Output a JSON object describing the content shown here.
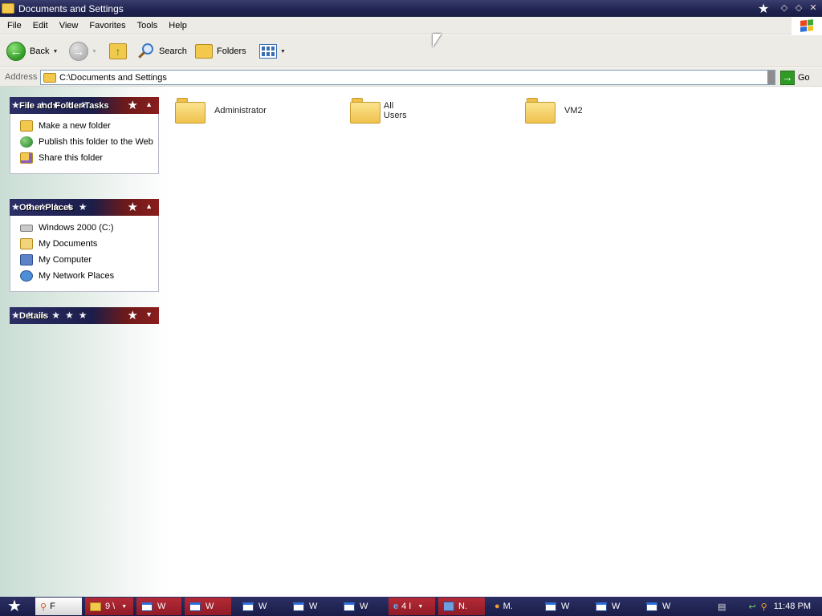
{
  "window": {
    "title": "Documents and Settings"
  },
  "menu": [
    "File",
    "Edit",
    "View",
    "Favorites",
    "Tools",
    "Help"
  ],
  "toolbar": {
    "back_label": "Back",
    "search_label": "Search",
    "folders_label": "Folders"
  },
  "address": {
    "label": "Address",
    "value": "C:\\Documents and Settings",
    "go_label": "Go"
  },
  "panels": {
    "tasks": {
      "title": "File and Folder Tasks",
      "items": [
        "Make a new folder",
        "Publish this folder to the Web",
        "Share this folder"
      ]
    },
    "other": {
      "title": "Other Places",
      "items": [
        "Windows 2000 (C:)",
        "My Documents",
        "My Computer",
        "My Network Places"
      ]
    },
    "details": {
      "title": "Details"
    }
  },
  "folders": [
    "Administrator",
    "All Users",
    "VM2"
  ],
  "taskbar": {
    "items": [
      "F",
      "9 \\",
      "W",
      "W",
      "W",
      "W",
      "W",
      "4 I",
      "N.",
      "M.",
      "W",
      "W",
      "W"
    ],
    "clock": "11:48 PM"
  },
  "icons": {
    "back": "back-arrow-icon",
    "forward": "forward-arrow-icon",
    "up": "up-folder-icon",
    "search": "search-icon",
    "folders": "folders-icon",
    "views": "views-icon",
    "go": "go-arrow-icon"
  }
}
